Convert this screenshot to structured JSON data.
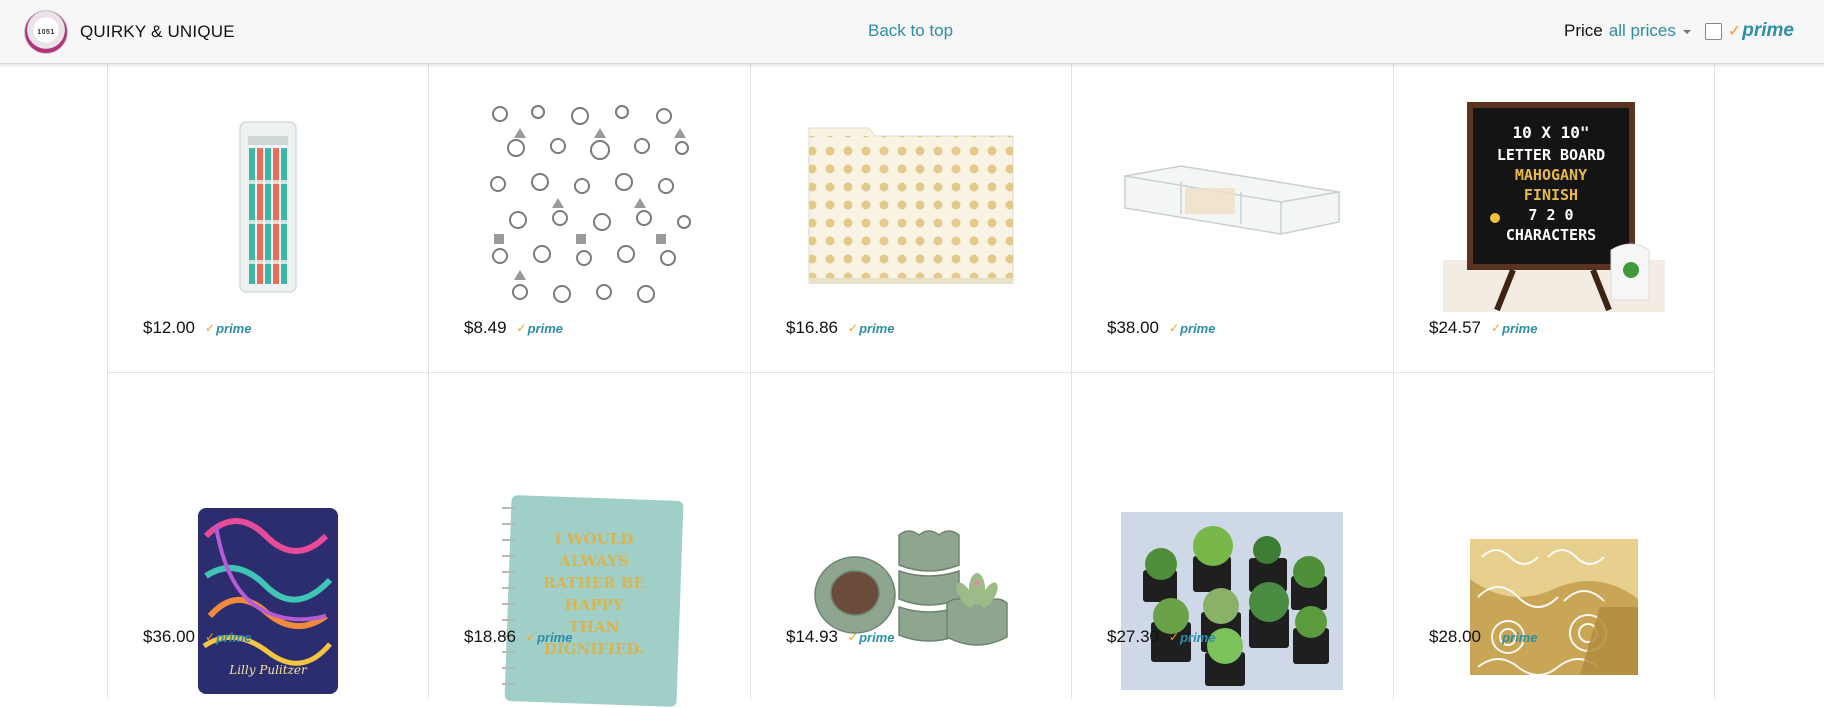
{
  "header": {
    "store_logo_text": "1051",
    "store_name": "QUIRKY & UNIQUE",
    "back_to_top": "Back to top",
    "price_label": "Price",
    "price_value": "all prices",
    "prime_label": "prime"
  },
  "products": [
    {
      "price": "$12.00",
      "prime": "prime",
      "image": "pencil-set-image"
    },
    {
      "price": "$8.49",
      "prime": "prime",
      "image": "silver-charms-image"
    },
    {
      "price": "$16.86",
      "prime": "prime",
      "image": "polka-dot-folder-image"
    },
    {
      "price": "$38.00",
      "prime": "prime",
      "image": "acrylic-tray-image"
    },
    {
      "price": "$24.57",
      "prime": "prime",
      "image": "letter-board-image",
      "image_text": [
        "10 X 10\"",
        "LETTER BOARD",
        "MAHOGANY",
        "FINISH",
        "7 2 0",
        "CHARACTERS"
      ]
    },
    {
      "price": "$36.00",
      "prime": "prime",
      "image": "patterned-notebook-image",
      "image_text": [
        "Lilly Pulitzer"
      ]
    },
    {
      "price": "$18.86",
      "prime": "prime",
      "image": "quote-notebook-image",
      "image_text": [
        "I WOULD",
        "ALWAYS",
        "RATHER BE",
        "HAPPY",
        "THAN",
        "DIGNIFIED."
      ]
    },
    {
      "price": "$14.93",
      "prime": "prime",
      "image": "ceramic-pots-image"
    },
    {
      "price": "$27.30",
      "prime": "prime",
      "image": "succulents-image"
    },
    {
      "price": "$28.00",
      "prime": "prime",
      "image": "gold-folder-image"
    }
  ],
  "colors": {
    "link": "#2d8ea6",
    "prime_check": "#f0a41f",
    "header_bg": "#f7f7f7"
  }
}
